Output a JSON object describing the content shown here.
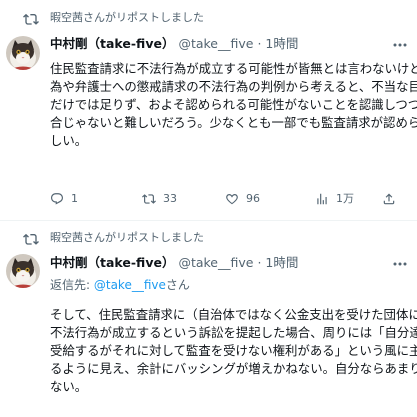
{
  "tweets": [
    {
      "retweet_label": "暇空茜さんがリポストしました",
      "display_name": "中村剛（take-five）",
      "handle": "@take__five",
      "separator": "·",
      "time": "1時間",
      "reply_prefix": "",
      "reply_handle": "",
      "reply_suffix": "",
      "body_lines": [
        "住民監査請求に不法行為が成立する可能性が皆無とは言わないけど、提訴行",
        "為や弁護士への懲戒請求の不法行為の判例から考えると、不当な目的がある",
        "だけでは足りず、およそ認められる可能性がないことを認識しつつやった場",
        "合じゃないと難しいだろう。少なくとも一部でも監査請求が認められたら厳",
        "しい。"
      ],
      "counts": {
        "reply": "1",
        "repost": "33",
        "like": "96",
        "views": "1万"
      }
    },
    {
      "retweet_label": "暇空茜さんがリポストしました",
      "display_name": "中村剛（take-five）",
      "handle": "@take__five",
      "separator": "·",
      "time": "1時間",
      "reply_prefix": "返信先: ",
      "reply_handle": "@take__five",
      "reply_suffix": "さん",
      "body_lines": [
        "そして、住民監査請求に（自治体ではなく公金支出を受けた団体に対して）",
        "不法行為が成立するという訴訟を提起した場合、周りには「自分達は公金を",
        "受給するがそれに対して監査を受けない権利がある」という風に主張してい",
        "るように見え、余計にバッシングが増えかねない。自分ならあまりお勧めし",
        "ない。"
      ]
    }
  ],
  "icons": [
    "repost-icon",
    "reply-icon",
    "like-icon",
    "views-icon",
    "bookmark-icon",
    "share-icon",
    "more-icon"
  ],
  "colors": {
    "link": "#1d9bf0",
    "secondary_text": "#536471",
    "divider": "#eff3f4"
  }
}
